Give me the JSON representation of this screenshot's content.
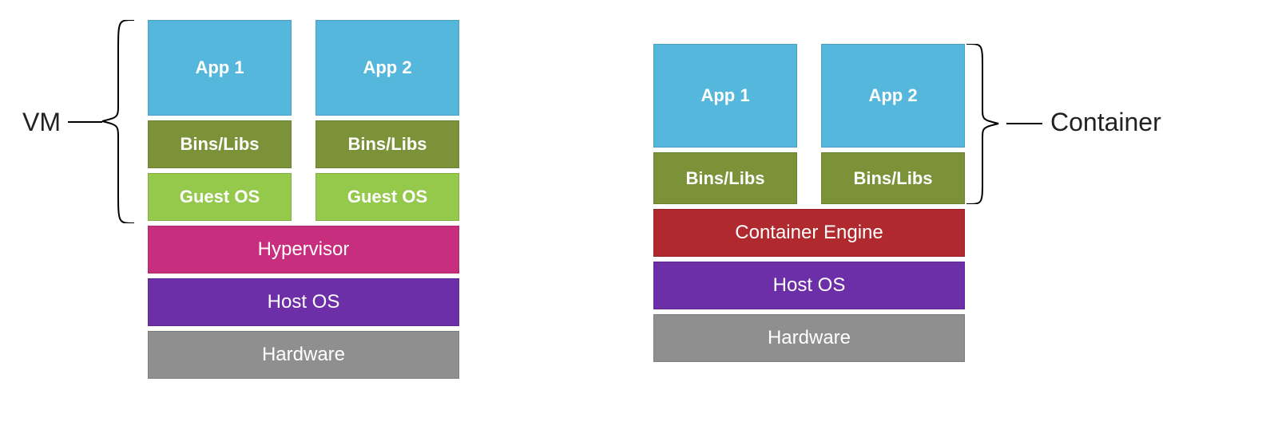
{
  "labels": {
    "vm": "VM",
    "container": "Container"
  },
  "vm_stack": {
    "pillars": [
      {
        "app": "App 1",
        "bins": "Bins/Libs",
        "gos": "Guest OS"
      },
      {
        "app": "App 2",
        "bins": "Bins/Libs",
        "gos": "Guest OS"
      }
    ],
    "base": {
      "hypervisor": "Hypervisor",
      "host_os": "Host OS",
      "hardware": "Hardware"
    }
  },
  "ct_stack": {
    "pillars": [
      {
        "app": "App 1",
        "bins": "Bins/Libs"
      },
      {
        "app": "App 2",
        "bins": "Bins/Libs"
      }
    ],
    "base": {
      "engine": "Container Engine",
      "host_os": "Host OS",
      "hardware": "Hardware"
    }
  }
}
